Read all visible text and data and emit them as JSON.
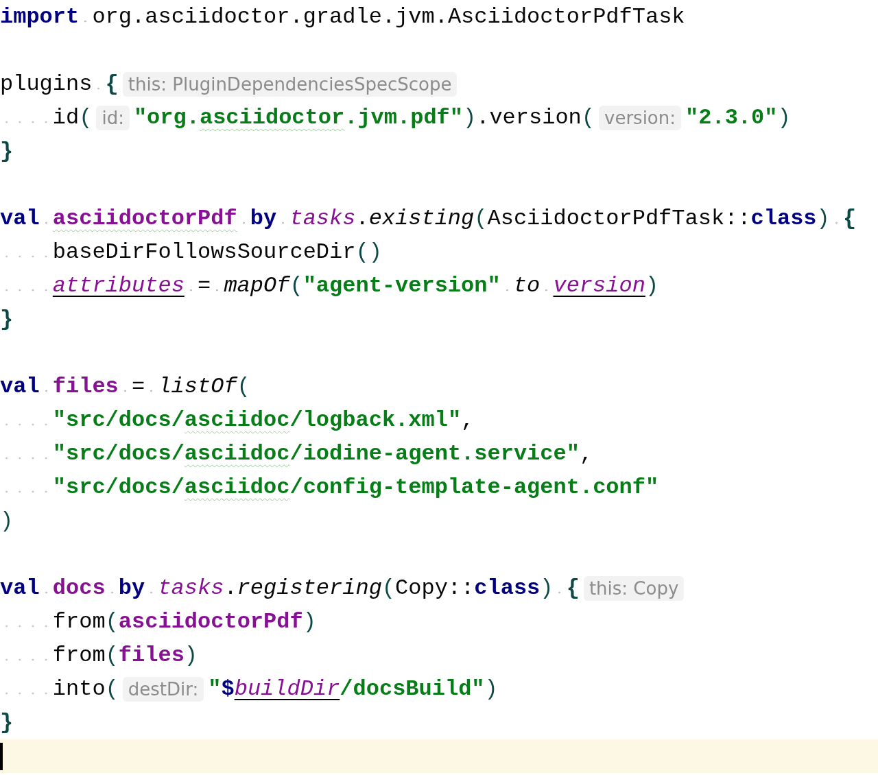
{
  "editor": {
    "lines": [
      {
        "current": false,
        "tokens": [
          {
            "kind": "keyword",
            "text": "import"
          },
          {
            "kind": "space"
          },
          {
            "kind": "identifier",
            "text": "org.asciidoctor.gradle.jvm.AsciidoctorPdfTask"
          }
        ]
      },
      {
        "current": false
      },
      {
        "current": false,
        "tokens": [
          {
            "kind": "identifier",
            "text": "plugins"
          },
          {
            "kind": "space"
          },
          {
            "kind": "brace",
            "text": "{"
          },
          {
            "kind": "hint",
            "text": "this: PluginDependenciesSpecScope"
          }
        ]
      },
      {
        "current": false,
        "tokens": [
          {
            "kind": "indent"
          },
          {
            "kind": "identifier",
            "text": "id"
          },
          {
            "kind": "paren",
            "text": "("
          },
          {
            "kind": "hint",
            "text": "id:"
          },
          {
            "kind": "string",
            "text": "\"org."
          },
          {
            "kind": "typo-string",
            "text": "asciidoctor"
          },
          {
            "kind": "string",
            "text": ".jvm.pdf\""
          },
          {
            "kind": "paren",
            "text": ")"
          },
          {
            "kind": "punctuation",
            "text": "."
          },
          {
            "kind": "identifier",
            "text": "version"
          },
          {
            "kind": "paren",
            "text": "("
          },
          {
            "kind": "hint",
            "text": "version:"
          },
          {
            "kind": "string",
            "text": "\"2.3.0\""
          },
          {
            "kind": "paren",
            "text": ")"
          }
        ]
      },
      {
        "current": false,
        "tokens": [
          {
            "kind": "brace",
            "text": "}"
          }
        ]
      },
      {
        "current": false
      },
      {
        "current": false,
        "tokens": [
          {
            "kind": "keyword",
            "text": "val"
          },
          {
            "kind": "space"
          },
          {
            "kind": "typo-property",
            "text": "asciidoctorPdf"
          },
          {
            "kind": "space"
          },
          {
            "kind": "keyword",
            "text": "by"
          },
          {
            "kind": "space"
          },
          {
            "kind": "receiver",
            "text": "tasks"
          },
          {
            "kind": "punctuation",
            "text": "."
          },
          {
            "kind": "function",
            "text": "existing"
          },
          {
            "kind": "paren",
            "text": "("
          },
          {
            "kind": "identifier",
            "text": "AsciidoctorPdfTask"
          },
          {
            "kind": "operator",
            "text": "::"
          },
          {
            "kind": "keyword",
            "text": "class"
          },
          {
            "kind": "paren",
            "text": ")"
          },
          {
            "kind": "space"
          },
          {
            "kind": "brace",
            "text": "{"
          }
        ]
      },
      {
        "current": false,
        "tokens": [
          {
            "kind": "indent"
          },
          {
            "kind": "identifier",
            "text": "baseDirFollowsSourceDir"
          },
          {
            "kind": "paren",
            "text": "("
          },
          {
            "kind": "paren",
            "text": ")"
          }
        ]
      },
      {
        "current": false,
        "tokens": [
          {
            "kind": "indent"
          },
          {
            "kind": "reference",
            "text": "attributes"
          },
          {
            "kind": "space"
          },
          {
            "kind": "operator",
            "text": "="
          },
          {
            "kind": "space"
          },
          {
            "kind": "function",
            "text": "mapOf"
          },
          {
            "kind": "paren",
            "text": "("
          },
          {
            "kind": "string",
            "text": "\"agent-version\""
          },
          {
            "kind": "space"
          },
          {
            "kind": "function",
            "text": "to"
          },
          {
            "kind": "space"
          },
          {
            "kind": "reference",
            "text": "version"
          },
          {
            "kind": "paren",
            "text": ")"
          }
        ]
      },
      {
        "current": false,
        "tokens": [
          {
            "kind": "brace",
            "text": "}"
          }
        ]
      },
      {
        "current": false
      },
      {
        "current": false,
        "tokens": [
          {
            "kind": "keyword",
            "text": "val"
          },
          {
            "kind": "space"
          },
          {
            "kind": "property",
            "text": "files"
          },
          {
            "kind": "space"
          },
          {
            "kind": "operator",
            "text": "="
          },
          {
            "kind": "space"
          },
          {
            "kind": "function",
            "text": "listOf"
          },
          {
            "kind": "paren",
            "text": "("
          }
        ]
      },
      {
        "current": false,
        "tokens": [
          {
            "kind": "indent"
          },
          {
            "kind": "string",
            "text": "\"src/docs/"
          },
          {
            "kind": "typo-string",
            "text": "asciidoc"
          },
          {
            "kind": "string",
            "text": "/logback.xml\""
          },
          {
            "kind": "punctuation",
            "text": ","
          }
        ]
      },
      {
        "current": false,
        "tokens": [
          {
            "kind": "indent"
          },
          {
            "kind": "string",
            "text": "\"src/docs/"
          },
          {
            "kind": "typo-string",
            "text": "asciidoc"
          },
          {
            "kind": "string",
            "text": "/iodine-agent.service\""
          },
          {
            "kind": "punctuation",
            "text": ","
          }
        ]
      },
      {
        "current": false,
        "tokens": [
          {
            "kind": "indent"
          },
          {
            "kind": "string",
            "text": "\"src/docs/"
          },
          {
            "kind": "typo-string",
            "text": "asciidoc"
          },
          {
            "kind": "string",
            "text": "/config-template-agent.conf\""
          }
        ]
      },
      {
        "current": false,
        "tokens": [
          {
            "kind": "paren",
            "text": ")"
          }
        ]
      },
      {
        "current": false
      },
      {
        "current": false,
        "tokens": [
          {
            "kind": "keyword",
            "text": "val"
          },
          {
            "kind": "space"
          },
          {
            "kind": "property",
            "text": "docs"
          },
          {
            "kind": "space"
          },
          {
            "kind": "keyword",
            "text": "by"
          },
          {
            "kind": "space"
          },
          {
            "kind": "receiver",
            "text": "tasks"
          },
          {
            "kind": "punctuation",
            "text": "."
          },
          {
            "kind": "function",
            "text": "registering"
          },
          {
            "kind": "paren",
            "text": "("
          },
          {
            "kind": "identifier",
            "text": "Copy"
          },
          {
            "kind": "operator",
            "text": "::"
          },
          {
            "kind": "keyword",
            "text": "class"
          },
          {
            "kind": "paren",
            "text": ")"
          },
          {
            "kind": "space"
          },
          {
            "kind": "brace",
            "text": "{"
          },
          {
            "kind": "hint",
            "text": "this: Copy"
          }
        ]
      },
      {
        "current": false,
        "tokens": [
          {
            "kind": "indent"
          },
          {
            "kind": "identifier",
            "text": "from"
          },
          {
            "kind": "paren",
            "text": "("
          },
          {
            "kind": "property",
            "text": "asciidoctorPdf"
          },
          {
            "kind": "paren",
            "text": ")"
          }
        ]
      },
      {
        "current": false,
        "tokens": [
          {
            "kind": "indent"
          },
          {
            "kind": "identifier",
            "text": "from"
          },
          {
            "kind": "paren",
            "text": "("
          },
          {
            "kind": "property",
            "text": "files"
          },
          {
            "kind": "paren",
            "text": ")"
          }
        ]
      },
      {
        "current": false,
        "tokens": [
          {
            "kind": "indent"
          },
          {
            "kind": "identifier",
            "text": "into"
          },
          {
            "kind": "paren",
            "text": "("
          },
          {
            "kind": "hint",
            "text": "destDir:"
          },
          {
            "kind": "string",
            "text": "\""
          },
          {
            "kind": "template-sign",
            "text": "$"
          },
          {
            "kind": "reference",
            "text": "buildDir"
          },
          {
            "kind": "string",
            "text": "/docsBuild\""
          },
          {
            "kind": "paren",
            "text": ")"
          }
        ]
      },
      {
        "current": false,
        "tokens": [
          {
            "kind": "brace",
            "text": "}"
          }
        ]
      },
      {
        "current": true
      }
    ]
  }
}
